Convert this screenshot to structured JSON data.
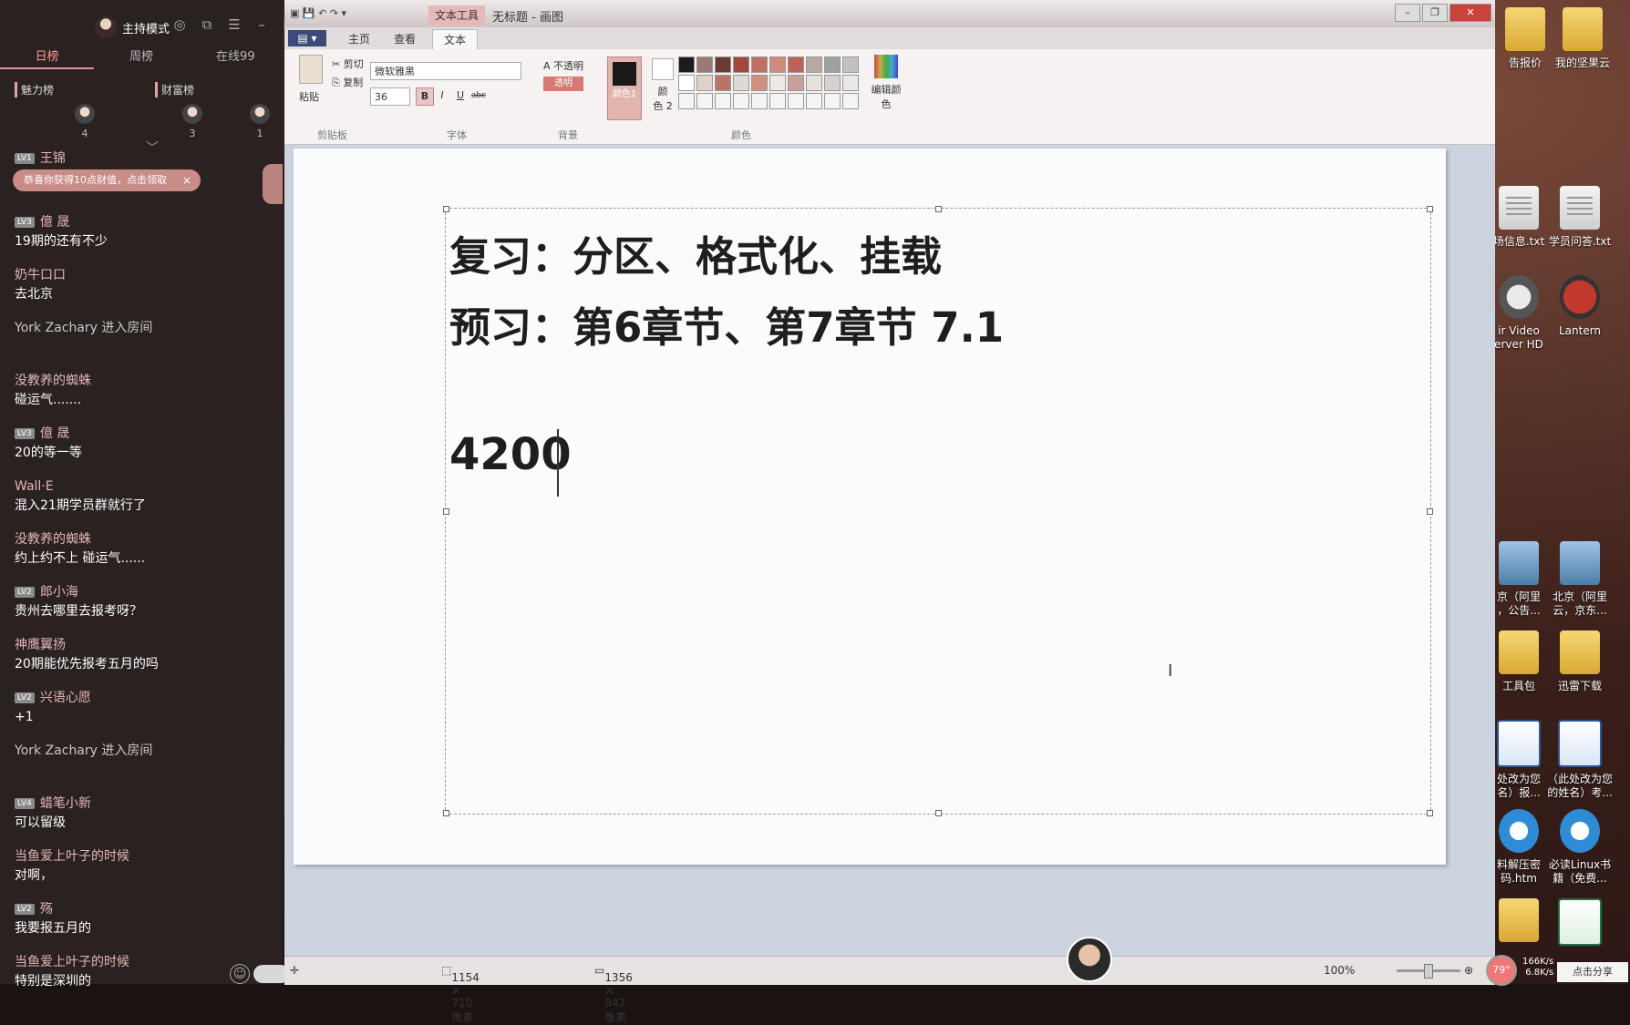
{
  "sidebar": {
    "header": {
      "mode_label": "主持模式"
    },
    "tabs": [
      "日榜",
      "周榜",
      "在线99"
    ],
    "ranks": {
      "charm": "魅力榜",
      "wealth": "财富榜",
      "counts": [
        "4",
        "3",
        "1"
      ]
    },
    "banner": "恭喜你获得10点财值，点击领取",
    "messages": [
      {
        "name": "王锦",
        "level": "LV1",
        "text": ""
      },
      {
        "name": "億 晟",
        "level": "LV3",
        "text": "19期的还有不少"
      },
      {
        "name": "奶牛口口",
        "level": "",
        "text": "去北京"
      },
      {
        "name": "York Zachary 进入房间",
        "level": "",
        "text": "",
        "enter": true
      },
      {
        "name": "没教养的蜘蛛",
        "level": "",
        "text": "碰运气......."
      },
      {
        "name": "億 晟",
        "level": "LV3",
        "text": "20的等一等"
      },
      {
        "name": "Wall·E",
        "level": "",
        "text": "混入21期学员群就行了"
      },
      {
        "name": "没教养的蜘蛛",
        "level": "",
        "text": "约上约不上 碰运气......"
      },
      {
        "name": "郎小海",
        "level": "LV2",
        "text": "贵州去哪里去报考呀？"
      },
      {
        "name": "神鹰翼扬",
        "level": "",
        "text": "20期能优先报考五月的吗"
      },
      {
        "name": "兴语心愿",
        "level": "LV2",
        "text": "+1"
      },
      {
        "name": "York Zachary 进入房间",
        "level": "",
        "text": "",
        "enter": true
      },
      {
        "name": "蜡笔小新",
        "level": "LV4",
        "text": "可以留级"
      },
      {
        "name": "当鱼爱上叶子的时候",
        "level": "",
        "text": "对啊，"
      },
      {
        "name": "殇",
        "level": "LV2",
        "text": "我要报五月的"
      },
      {
        "name": "当鱼爱上叶子的时候",
        "level": "",
        "text": "特别是深圳的"
      }
    ]
  },
  "paint": {
    "context_tab": "文本工具",
    "window_title": "无标题 - 画图",
    "tabs": {
      "home": "主页",
      "view": "查看",
      "text": "文本"
    },
    "clipboard": {
      "paste": "粘贴",
      "cut": "剪切",
      "copy": "复制",
      "group": "剪贴板"
    },
    "font": {
      "name": "微软雅黑",
      "size": "36",
      "group": "字体",
      "bold": "B",
      "italic": "I",
      "underline": "U",
      "strike": "abc"
    },
    "background": {
      "opaque": "不透明",
      "transparent": "透明",
      "group": "背景"
    },
    "colors": {
      "color1": "颜色1",
      "color2_a": "颜",
      "color2_b": "色 2",
      "edit": "编辑颜色",
      "group": "颜色"
    },
    "palette": [
      "#1c1c1c",
      "#9a7a72",
      "#6b3a32",
      "#a4473c",
      "#c07060",
      "#d08a7a",
      "#c06058",
      "#b8a8a0",
      "#a0a0a0",
      "#c0c0c0",
      "#ffffff",
      "#e0d0cc",
      "#b87468",
      "#e0d8d4",
      "#d09080",
      "#f0e8e4",
      "#c8a098",
      "#e8e0dc",
      "#d8d0cc",
      "#e8e8e8",
      "#f4f4f4",
      "#f4f4f4",
      "#f4f4f4",
      "#f4f4f4",
      "#f4f4f4",
      "#f4f4f4",
      "#f4f4f4",
      "#f4f4f4",
      "#f4f4f4",
      "#f4f4f4"
    ],
    "canvas": {
      "line1": "复习：分区、格式化、挂载",
      "line2": "预习：第6章节、第7章节 7.1",
      "line3": "4200"
    },
    "status": {
      "selection": "1154 × 710像素",
      "image_size": "1356 × 847像素",
      "zoom": "100%"
    }
  },
  "desktop": {
    "icons": [
      "告报价",
      "我的坚果云",
      "场信息.txt",
      "学员问答.txt",
      "ir Video\nerver HD",
      "Lantern",
      "京（阿里\n，公告...",
      "北京（阿里\n云，京东...",
      "工具包",
      "迅雷下载",
      "处改为您\n名）报...",
      "（此处改为您\n的姓名）考...",
      "料解压密\n码.htm",
      "必读Linux书\n籍（免费...",
      "",
      ""
    ]
  },
  "tray": {
    "cpu": "79°",
    "up": "166K/s",
    "down": "6.8K/s",
    "share": "点击分享"
  }
}
